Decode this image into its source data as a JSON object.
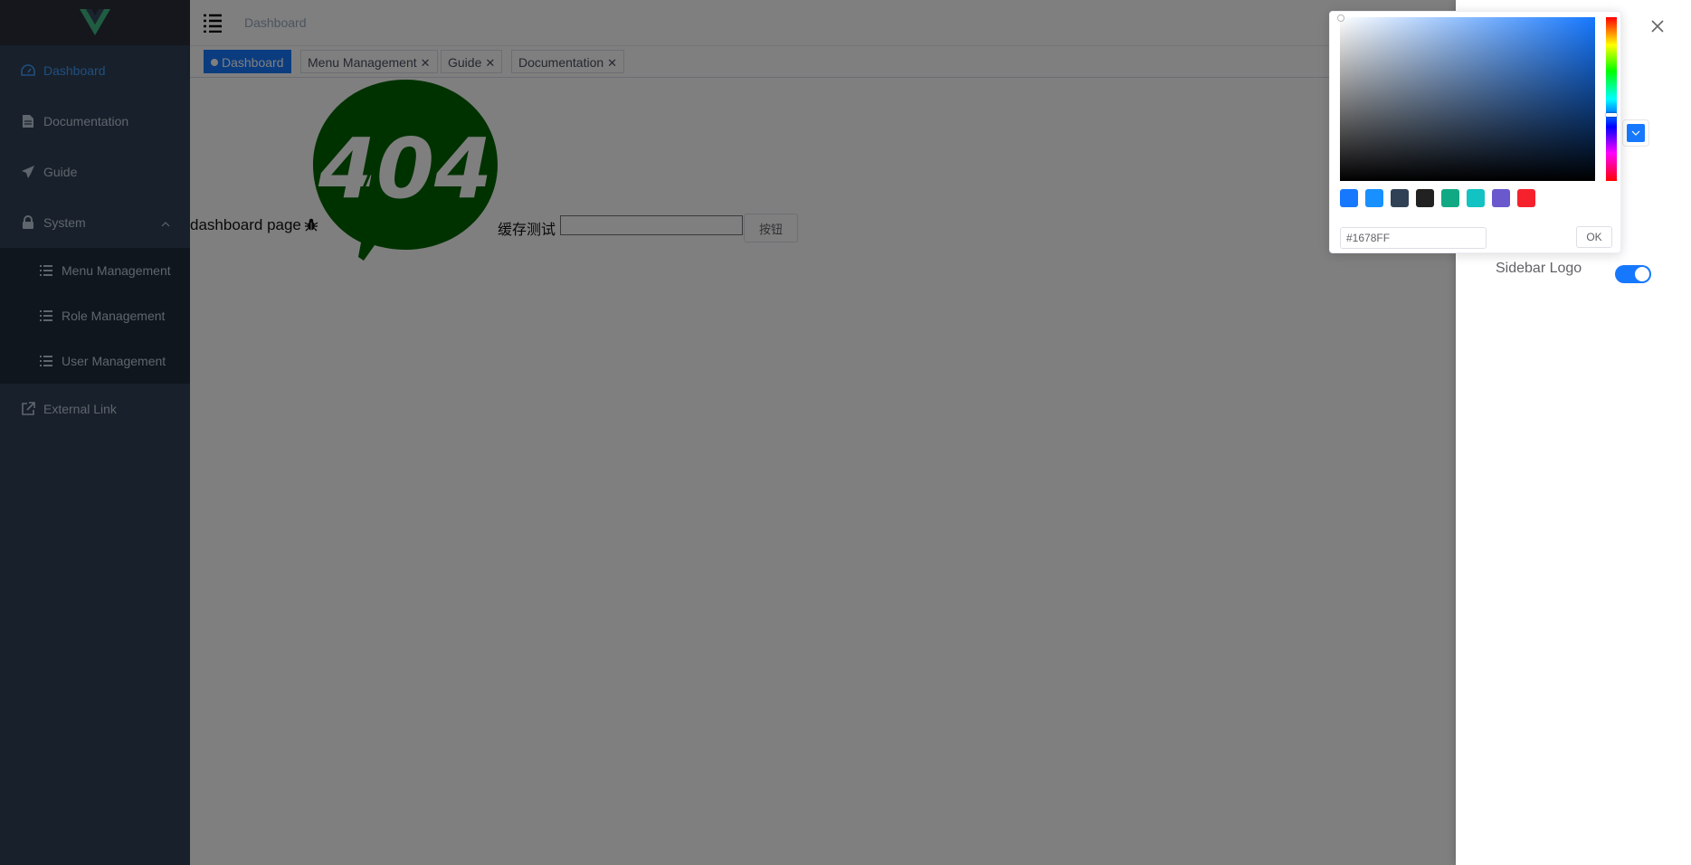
{
  "sidebar": {
    "items": [
      {
        "label": "Dashboard",
        "icon": "dashboard-icon"
      },
      {
        "label": "Documentation",
        "icon": "document-icon"
      },
      {
        "label": "Guide",
        "icon": "guide-icon"
      },
      {
        "label": "System",
        "icon": "lock-icon"
      },
      {
        "label": "Menu Management",
        "icon": "list-icon"
      },
      {
        "label": "Role Management",
        "icon": "list-icon"
      },
      {
        "label": "User Management",
        "icon": "list-icon"
      },
      {
        "label": "External Link",
        "icon": "external-link-icon"
      }
    ]
  },
  "navbar": {
    "breadcrumb": "Dashboard"
  },
  "tags": [
    {
      "label": "Dashboard"
    },
    {
      "label": "Menu Management"
    },
    {
      "label": "Guide"
    },
    {
      "label": "Documentation"
    }
  ],
  "main": {
    "page_text": "dashboard page",
    "image_text": "404",
    "cache_label": "缓存测试",
    "cache_value": "",
    "button_label": "按钮"
  },
  "settings": {
    "sidebar_logo_label": "Sidebar Logo",
    "sidebar_logo_on": true,
    "theme_color": "#1678FF"
  },
  "color_picker": {
    "hex": "#1678FF",
    "ok_label": "OK",
    "predefined": [
      "#1678ff",
      "#1890ff",
      "#304156",
      "#212121",
      "#11a983",
      "#13c2c2",
      "#6959cd",
      "#f5222d"
    ]
  },
  "colors": {
    "accent": "#1678ff",
    "sidebar_bg": "#304156",
    "sidebar_text": "#bfcbd9",
    "image_green": "#006400"
  }
}
